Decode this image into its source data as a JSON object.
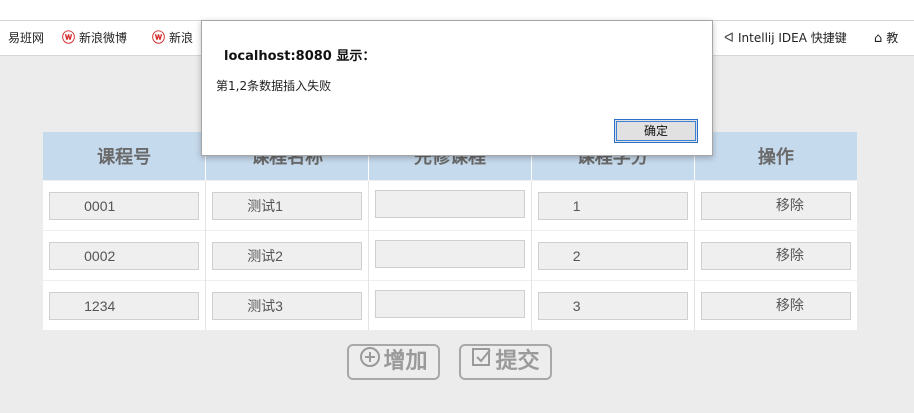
{
  "bookmarks": [
    {
      "label": "易班网"
    },
    {
      "label": "新浪微博",
      "icon": "weibo-icon"
    },
    {
      "label": "新浪",
      "icon": "weibo-icon"
    },
    {
      "label": "Intellij IDEA 快捷键",
      "icon": "kotlin-icon"
    },
    {
      "label": "教",
      "icon": "bank-icon"
    }
  ],
  "table": {
    "headers": [
      "课程号",
      "课程名称",
      "先修课程",
      "课程学分",
      "操作"
    ],
    "rows": [
      {
        "id": "0001",
        "name": "测试1",
        "prereq": "",
        "credit": "1",
        "action": "移除"
      },
      {
        "id": "0002",
        "name": "测试2",
        "prereq": "",
        "credit": "2",
        "action": "移除"
      },
      {
        "id": "1234",
        "name": "测试3",
        "prereq": "",
        "credit": "3",
        "action": "移除"
      }
    ]
  },
  "actions": {
    "add_label": "增加",
    "submit_label": "提交"
  },
  "dialog": {
    "title": "localhost:8080 显示：",
    "message": "第1,2条数据插入失败",
    "ok_label": "确定"
  },
  "colors": {
    "header_bg": "#c6daed",
    "page_bg": "#ececec",
    "ok_border": "#2a6fc9",
    "weibo_red": "#d52b2b"
  }
}
